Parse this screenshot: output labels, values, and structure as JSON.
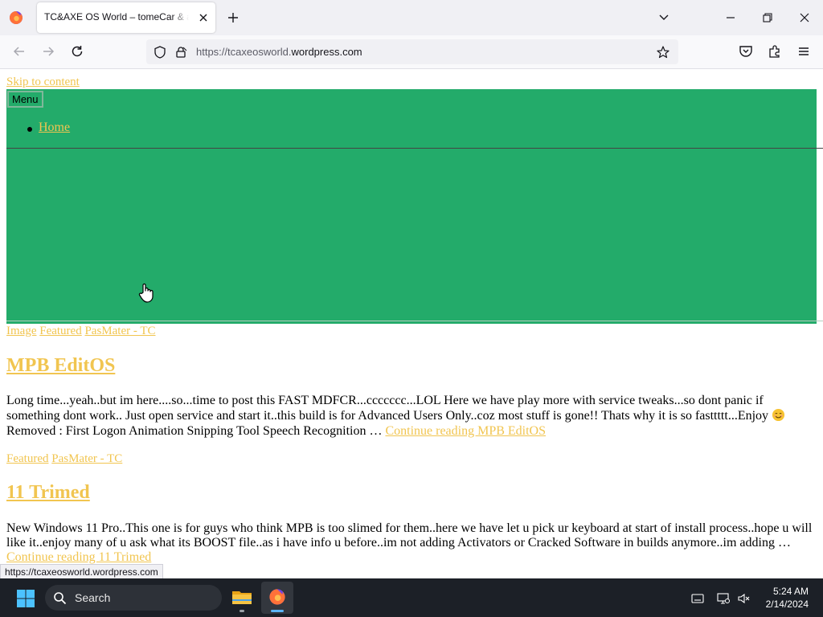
{
  "browser": {
    "tab_title": "TC&AXE OS World – tomeCar & aXe",
    "url_prefix": "https://tcaxeosworld.",
    "url_host": "wordpress.com"
  },
  "page": {
    "skip_link": "Skip to content",
    "menu_button": "Menu",
    "nav_items": [
      "Home"
    ],
    "posts": [
      {
        "meta": [
          "Image",
          "Featured",
          "PasMater - TC"
        ],
        "title": "MPB EditOS",
        "excerpt_line1": "Long time...yeah..but im here....so...time to post this FAST MDFCR...ccccccc...LOL Here we have play more with service tweaks...so dont panic if",
        "excerpt_line2": "something dont work.. Just open service and start it..this build is for Advanced Users Only..coz most stuff is gone!! Thats why it is so fasttttt...Enjoy",
        "excerpt_line3": "Removed : First Logon Animation Snipping Tool Speech Recognition …",
        "continue": "Continue reading MPB EditOS"
      },
      {
        "meta": [
          "Featured",
          "PasMater - TC"
        ],
        "title": "11 Trimed",
        "excerpt_line1": "New Windows 11 Pro..This one is for guys who think MPB is too slimed for them..here we have let u pick ur keyboard at start of install process..hope u will",
        "excerpt_line2": "like it..enjoy many of u ask what its BOOST file..as i have info u before..im not adding Activators or Cracked Software in builds anymore..im adding …",
        "continue": "Continue reading 11 Trimed"
      }
    ]
  },
  "status_bar": "https://tcaxeosworld.wordpress.com",
  "taskbar": {
    "search_label": "Search",
    "time": "5:24 AM",
    "date": "2/14/2024"
  },
  "colors": {
    "header_green": "#23ab6a",
    "link_yellow": "#f1c550",
    "taskbar_bg": "#1c2027"
  },
  "icons": [
    "firefox-icon",
    "close-icon",
    "plus-icon",
    "chevron-down-icon",
    "minimize-icon",
    "restore-icon",
    "back-icon",
    "forward-icon",
    "reload-icon",
    "shield-icon",
    "lock-icon",
    "star-icon",
    "pocket-icon",
    "extensions-icon",
    "hamburger-menu-icon",
    "windows-start-icon",
    "search-icon",
    "file-explorer-icon",
    "keyboard-icon",
    "network-icon",
    "volume-muted-icon",
    "hand-cursor-icon"
  ]
}
